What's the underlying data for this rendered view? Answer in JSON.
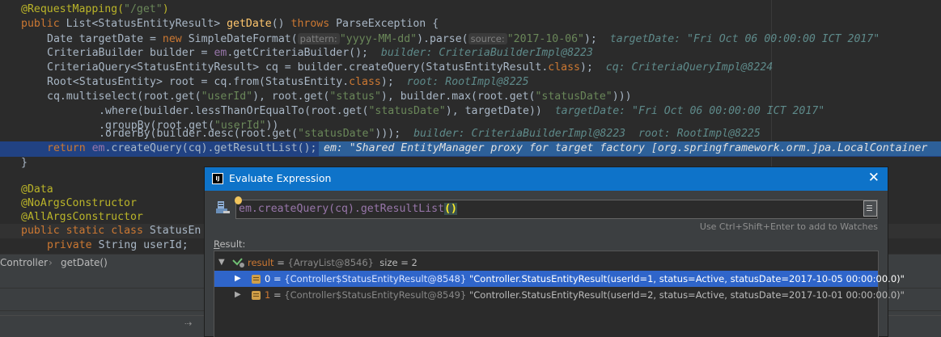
{
  "editor": {
    "lines": [
      [
        "@RequestMapping(",
        "\"/get\"",
        ")"
      ],
      [
        "public",
        "List<StatusEntityResult>",
        "getDate",
        "() ",
        "throws",
        " ParseException {"
      ],
      [
        "Date targetDate = ",
        "new",
        " SimpleDateFormat(",
        "pattern:",
        "\"yyyy-MM-dd\"",
        ").parse(",
        "source:",
        "\"2017-10-06\"",
        ");",
        "targetDate: \"Fri Oct 06 00:00:00 ICT 2017\""
      ],
      [
        "CriteriaBuilder builder = ",
        "em",
        ".getCriteriaBuilder();",
        "builder: CriteriaBuilderImpl@8223"
      ],
      [
        "CriteriaQuery<StatusEntityResult> cq = builder.createQuery(StatusEntityResult.",
        "class",
        ");",
        "cq: CriteriaQueryImpl@8224"
      ],
      [
        "Root<StatusEntity> root = cq.from(StatusEntity.",
        "class",
        ");",
        "root: RootImpl@8225"
      ],
      [
        "cq.multiselect(root.get(",
        "\"userId\"",
        "), root.get(",
        "\"status\"",
        "), builder.max(root.get(",
        "\"statusDate\"",
        ")))"
      ],
      [
        ".where(builder.lessThanOrEqualTo(root.get(",
        "\"statusDate\"",
        "), targetDate))",
        "targetDate: \"Fri Oct 06 00:00:00 ICT 2017\""
      ],
      [
        ".groupBy(root.get(",
        "\"userId\"",
        "))"
      ],
      [
        ".orderBy(builder.desc(root.get(",
        "\"statusDate\"",
        ")));",
        "builder: CriteriaBuilderImpl@8223  root: RootImpl@8225"
      ],
      [
        "return",
        "em",
        ".createQuery(cq).getResultList();",
        "em: \"Shared EntityManager proxy for target factory [org.springframework.orm.jpa.LocalContainer"
      ],
      [
        "}"
      ],
      [
        ""
      ],
      [
        "@Data"
      ],
      [
        "@NoArgsConstructor"
      ],
      [
        "@AllArgsConstructor"
      ],
      [
        "public",
        "static",
        "class",
        "StatusEn"
      ],
      [
        "private",
        "String userId;"
      ]
    ]
  },
  "breadcrumb": {
    "items": [
      "Controller",
      "getDate()"
    ],
    "separator": "›"
  },
  "dialog": {
    "title": "Evaluate Expression",
    "close_label": "✕",
    "expression_main": "em.createQuery(cq).getResultList",
    "expression_parens": "()",
    "watch_hint": "Use Ctrl+Shift+Enter to add to Watches",
    "result_label_prefix": "R",
    "result_label_rest": "esult:",
    "tree": {
      "root": {
        "name": "result",
        "eq": " = ",
        "type": "{ArrayList@8546}",
        "value": "  size = 2"
      },
      "items": [
        {
          "name": "0",
          "eq": " = ",
          "type": "{Controller$StatusEntityResult@8548}",
          "value": " \"Controller.StatusEntityResult(userId=1, status=Active, statusDate=2017-10-05 00:00:00.0)\""
        },
        {
          "name": "1",
          "eq": " = ",
          "type": "{Controller$StatusEntityResult@8549}",
          "value": " \"Controller.StatusEntityResult(userId=2, status=Active, statusDate=2017-10-01 00:00:00.0)\""
        }
      ]
    }
  },
  "icons": {
    "close": "close-icon",
    "expand": "triangle-right-icon",
    "collapse": "triangle-down-icon",
    "pin": "pin-icon"
  },
  "colors": {
    "editor_bg": "#2b2b2b",
    "title_bar": "#0e73c9",
    "selection": "#2f65ca",
    "current_line": "#214283",
    "keyword": "#cc7832",
    "string": "#6a8759"
  }
}
